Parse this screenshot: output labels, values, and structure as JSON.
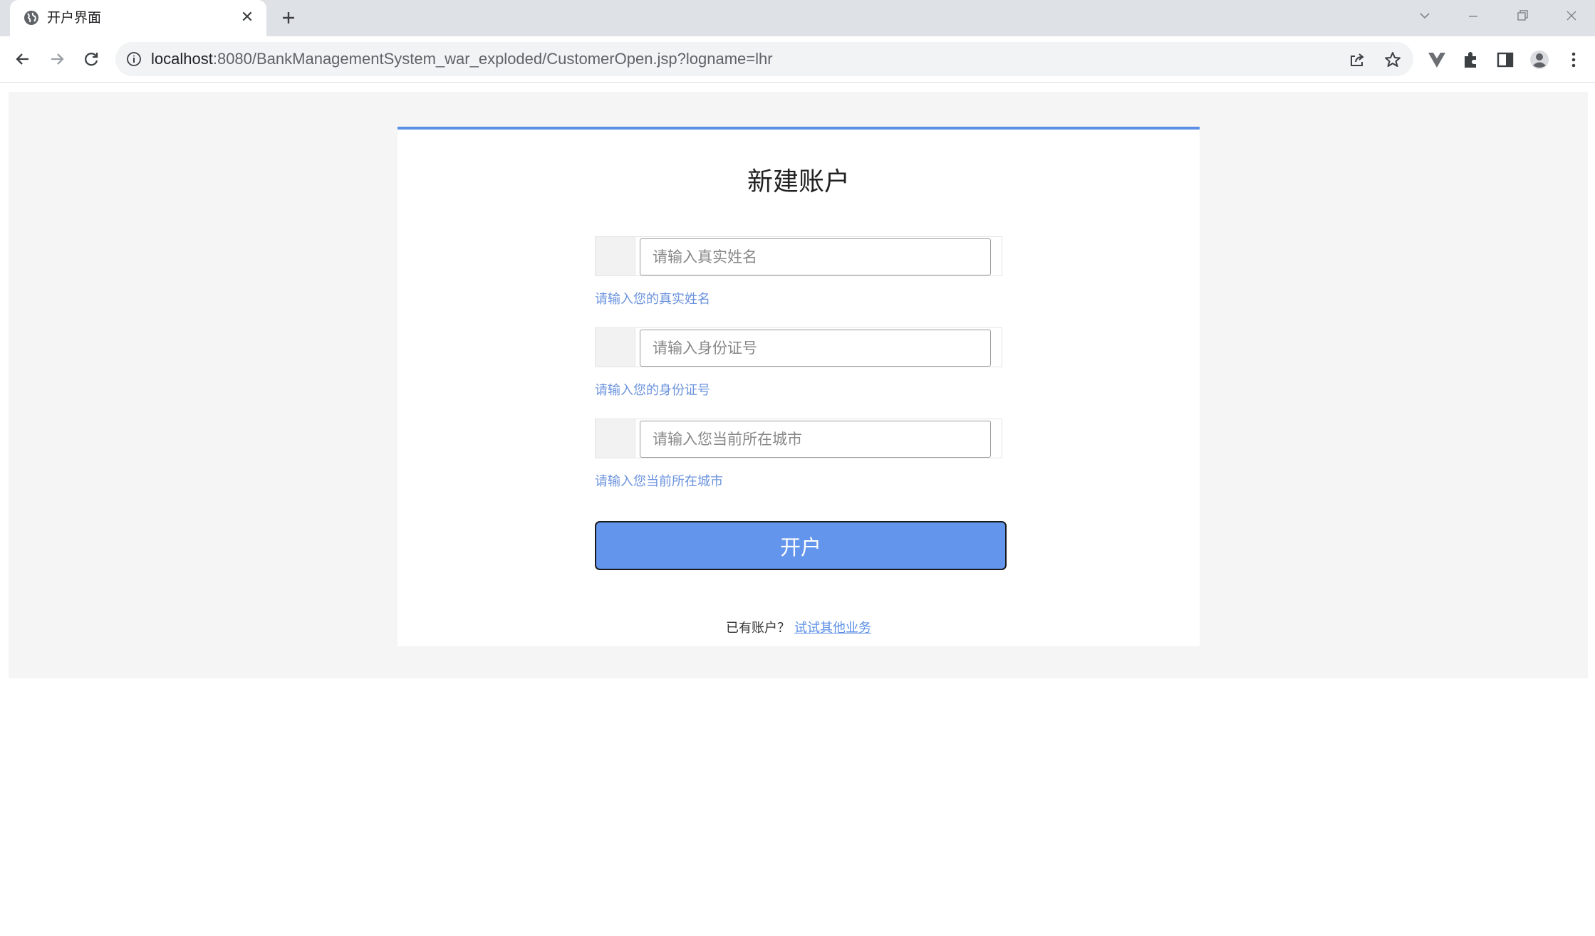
{
  "browser": {
    "tab_title": "开户界面",
    "url_host": "localhost",
    "url_rest": ":8080/BankManagementSystem_war_exploded/CustomerOpen.jsp?logname=lhr"
  },
  "page": {
    "title": "新建账户",
    "fields": [
      {
        "placeholder": "请输入真实姓名",
        "hint": "请输入您的真实姓名"
      },
      {
        "placeholder": "请输入身份证号",
        "hint": "请输入您的身份证号"
      },
      {
        "placeholder": "请输入您当前所在城市",
        "hint": "请输入您当前所在城市"
      }
    ],
    "submit_label": "开户",
    "footer_text": "已有账户？",
    "footer_link": "试试其他业务"
  },
  "colors": {
    "accent": "#5b8fe6",
    "button": "#6495ed",
    "hint": "#6b93dd",
    "page_bg": "#f5f5f5"
  }
}
